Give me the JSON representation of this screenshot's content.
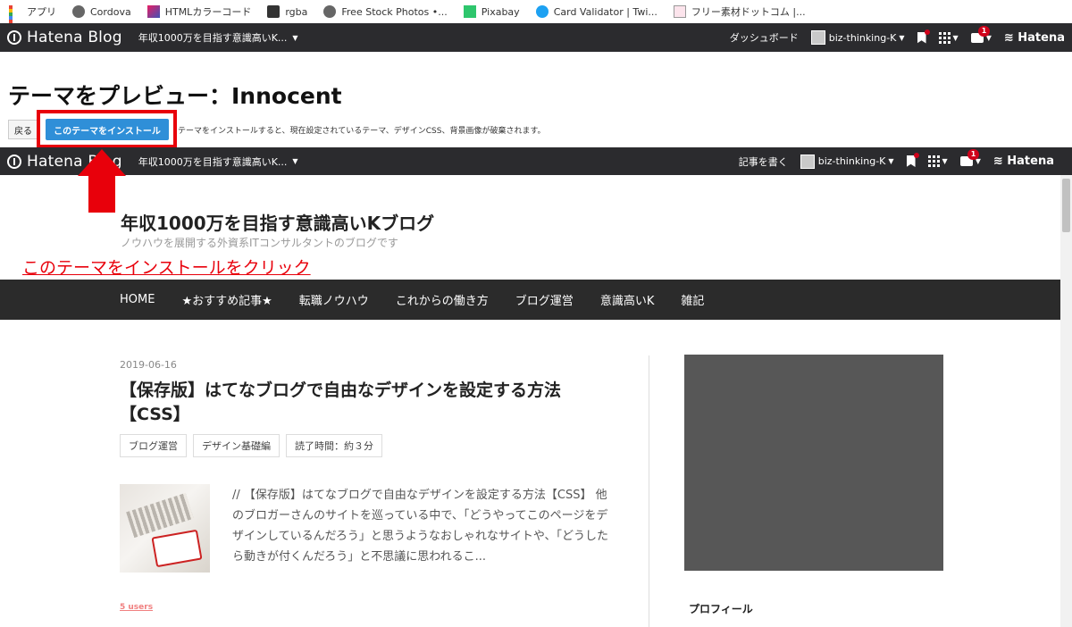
{
  "bookmarks": [
    {
      "label": "アプリ",
      "icon": "apps-grid-icon"
    },
    {
      "label": "Cordova",
      "icon": "globe-icon"
    },
    {
      "label": "HTMLカラーコード",
      "icon": "color-code-icon"
    },
    {
      "label": "rgba",
      "icon": "rgba-icon"
    },
    {
      "label": "Free Stock Photos •...",
      "icon": "globe-icon"
    },
    {
      "label": "Pixabay",
      "icon": "pixabay-icon"
    },
    {
      "label": "Card Validator | Twi...",
      "icon": "twitter-bird-icon"
    },
    {
      "label": "フリー素材ドットコム |...",
      "icon": "page-icon"
    }
  ],
  "hatena_bar": {
    "logo": "Hatena Blog",
    "blog_name": "年収1000万を目指す意識高いK...",
    "dashboard": "ダッシュボード",
    "write_article": "記事を書く",
    "user": "biz-thinking-K",
    "notification_count": "1",
    "brand": "Hatena"
  },
  "preview": {
    "title": "テーマをプレビュー：Innocent",
    "back_label": "戻る",
    "install_label": "このテーマをインストール",
    "warning": "テーマをインストールすると、現在設定されているテーマ、デザインCSS、背景画像が破棄されます。"
  },
  "annotation": "このテーマをインストールをクリック",
  "blog": {
    "title": "年収1000万を目指す意識高いKブログ",
    "description": "ノウハウを展開する外資系ITコンサルタントのブログです",
    "nav": [
      "HOME",
      "★おすすめ記事★",
      "転職ノウハウ",
      "これからの働き方",
      "ブログ運営",
      "意識高いK",
      "雑記"
    ],
    "article": {
      "date": "2019-06-16",
      "title": "【保存版】はてなブログで自由なデザインを設定する方法【CSS】",
      "tags": [
        "ブログ運営",
        "デザイン基礎編",
        "読了時間：約３分"
      ],
      "excerpt": "// 【保存版】はてなブログで自由なデザインを設定する方法【CSS】 他のブロガーさんのサイトを巡っている中で、「どうやってこのページをデザインしているんだろう」と思うようなおしゃれなサイトや、「どうしたら動きが付くんだろう」と不思議に思われるこ...",
      "users": "5 users"
    },
    "sidebar_heading": "プロフィール"
  },
  "colors": {
    "bar_bg": "#2b2b2e",
    "install_blue": "#2f8fd8",
    "highlight_red": "#e8000b",
    "sidebar_image": "#575757"
  }
}
